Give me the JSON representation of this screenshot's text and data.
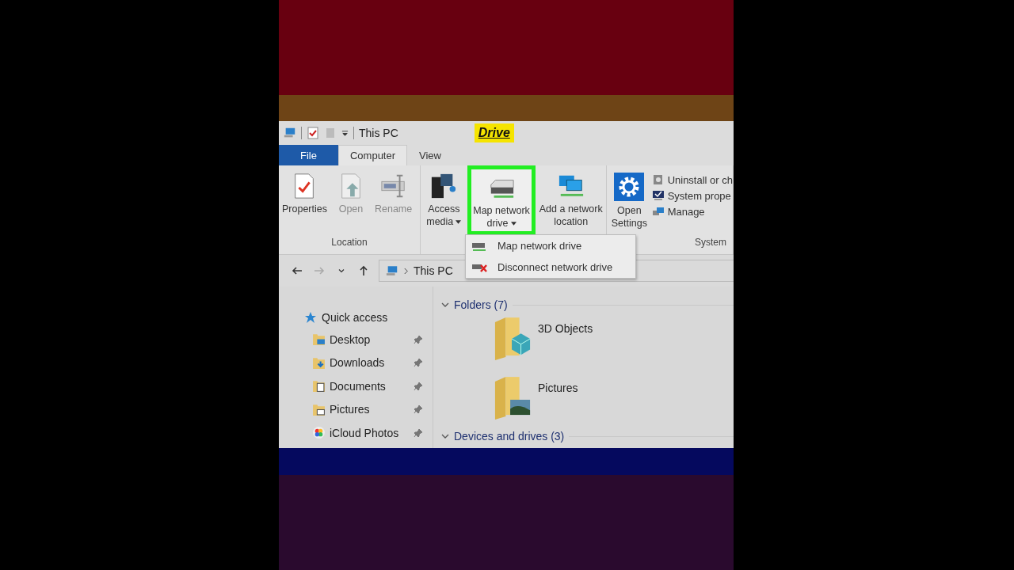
{
  "caption": "Drive",
  "window": {
    "title": "This PC"
  },
  "tabs": [
    {
      "label": "File",
      "kind": "file",
      "selected": false
    },
    {
      "label": "Computer",
      "kind": "tab",
      "selected": true
    },
    {
      "label": "View",
      "kind": "tab",
      "selected": false
    }
  ],
  "ribbon_groups": [
    {
      "label": "Location",
      "buttons": [
        {
          "label": "Properties",
          "disabled": false,
          "dropdown": false,
          "highlighted": false
        },
        {
          "label": "Open",
          "disabled": true,
          "dropdown": false,
          "highlighted": false
        },
        {
          "label": "Rename",
          "disabled": true,
          "dropdown": false,
          "highlighted": false
        }
      ]
    },
    {
      "buttons": [
        {
          "label": "Access media",
          "disabled": false,
          "dropdown": true,
          "highlighted": false
        },
        {
          "label": "Map network drive",
          "disabled": false,
          "dropdown": true,
          "highlighted": true
        },
        {
          "label": "Add a network location",
          "disabled": false,
          "dropdown": false,
          "highlighted": false
        }
      ]
    },
    {
      "label": "System",
      "buttons": [
        {
          "label": "Open Settings",
          "disabled": false,
          "dropdown": false,
          "highlighted": false
        }
      ],
      "small_buttons": [
        {
          "label": "Uninstall or ch"
        },
        {
          "label": "System prope"
        },
        {
          "label": "Manage"
        }
      ]
    }
  ],
  "dropdown_menu": [
    {
      "label": "Map network drive"
    },
    {
      "label": "Disconnect network drive"
    }
  ],
  "nav_buttons": [
    {
      "kind": "back",
      "disabled": false
    },
    {
      "kind": "forward",
      "disabled": true
    },
    {
      "kind": "recent",
      "disabled": false
    },
    {
      "kind": "up",
      "disabled": false
    }
  ],
  "address_bar": {
    "path": "This PC"
  },
  "sidebar": {
    "header": "Quick access",
    "items": [
      {
        "label": "Desktop",
        "pinned": true
      },
      {
        "label": "Downloads",
        "pinned": true
      },
      {
        "label": "Documents",
        "pinned": true
      },
      {
        "label": "Pictures",
        "pinned": true
      },
      {
        "label": "iCloud Photos",
        "pinned": true
      }
    ]
  },
  "sections": [
    {
      "title": "Folders (7)",
      "expanded": true,
      "items": [
        {
          "name": "3D Objects"
        },
        {
          "name": "Pictures"
        }
      ]
    },
    {
      "title": "Devices and drives (3)",
      "expanded": true
    }
  ]
}
